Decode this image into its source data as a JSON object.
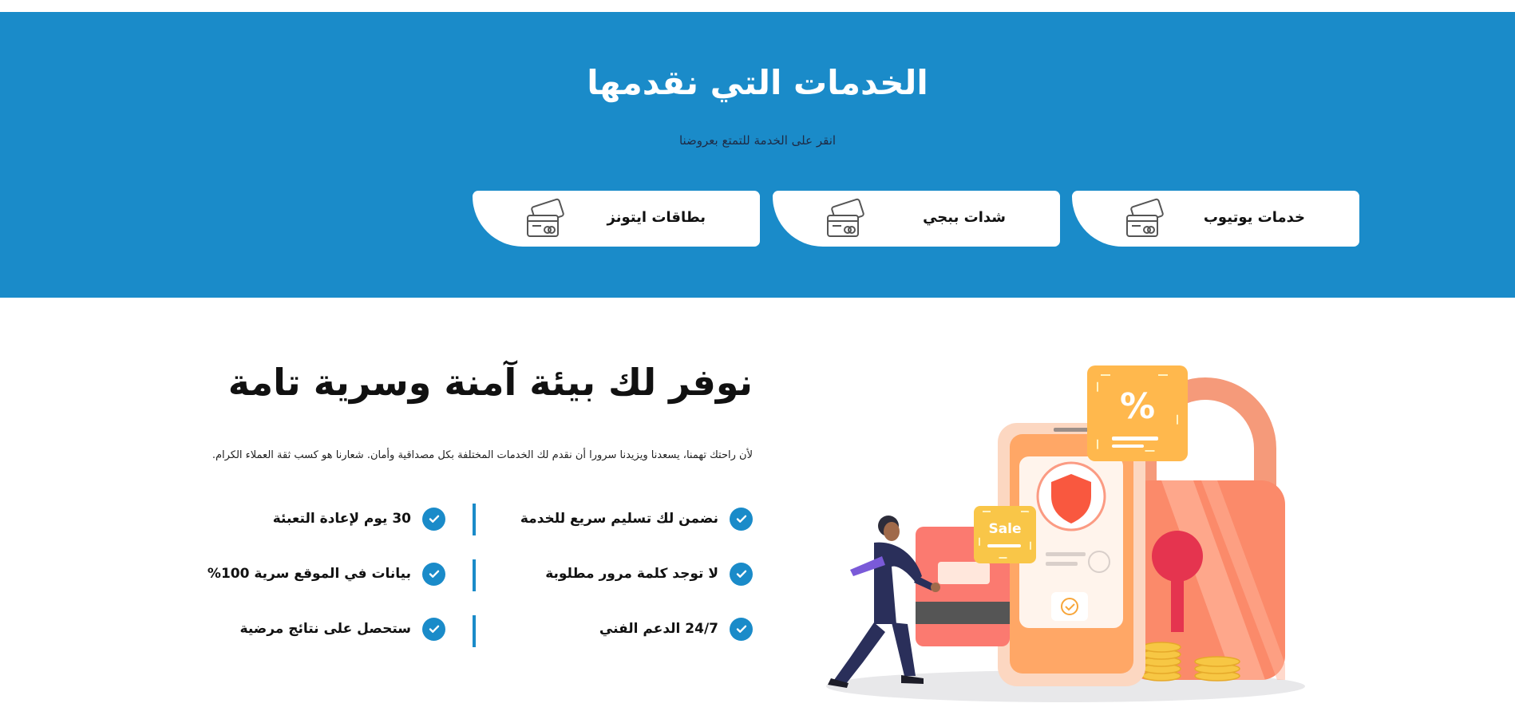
{
  "services": {
    "title": "الخدمات التي نقدمها",
    "subtitle": "انقر على الخدمة للتمتع بعروضنا",
    "cards": [
      {
        "label": "خدمات يوتيوب",
        "icon": "credit-cards-icon"
      },
      {
        "label": "شدات ببجي",
        "icon": "credit-cards-icon"
      },
      {
        "label": "بطاقات ايتونز",
        "icon": "credit-cards-icon"
      }
    ]
  },
  "secure": {
    "title": "نوفر لك بيئة آمنة وسرية تامة",
    "description": "لأن راحتك تهمنا، يسعدنا ويزيدنا سرورا أن نقدم لك الخدمات المختلفة بكل مصداقية وأمان. شعارنا هو كسب ثقة العملاء الكرام.",
    "features_right": [
      "نضمن لك تسليم سريع للخدمة",
      "لا توجد كلمة مرور مطلوبة",
      "24/7 الدعم الفني"
    ],
    "features_left": [
      "30 يوم لإعادة التعبئة",
      "بيانات في الموقع سرية 100%",
      "ستحصل على نتائج مرضية"
    ]
  },
  "illustration": {
    "badge_sale": "Sale",
    "badge_percent": "%"
  },
  "colors": {
    "brand_blue": "#1a8bc9",
    "dark_text": "#111111",
    "subtitle_text": "#1e2b45"
  }
}
